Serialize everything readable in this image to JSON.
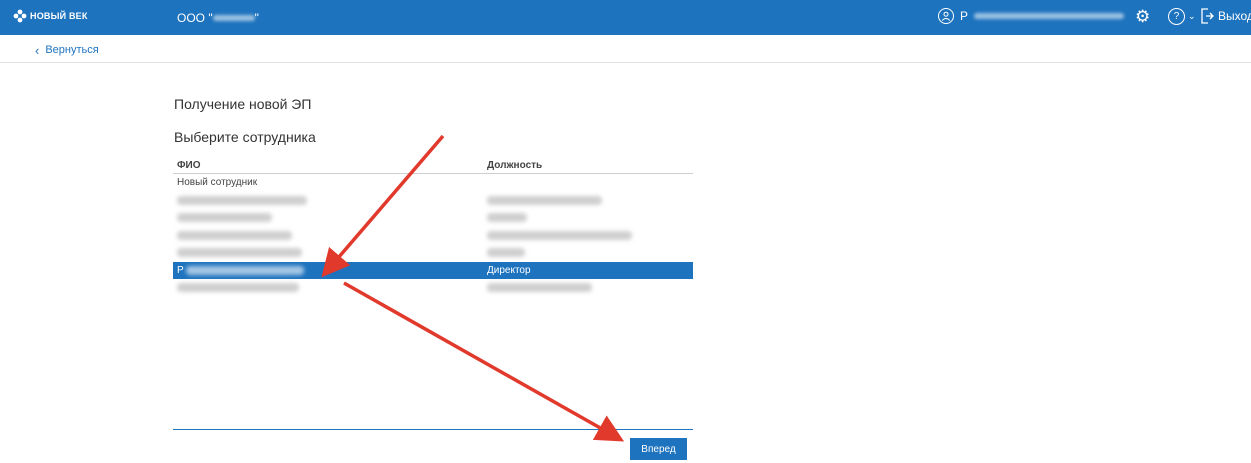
{
  "header": {
    "logo_text": "НОВЫЙ ВЕК",
    "logo_sub": "",
    "org_prefix": "ООО \"",
    "org_suffix": "\"",
    "exit_label": "Выход",
    "user_initial": "Р"
  },
  "nav": {
    "back_label": "Вернуться"
  },
  "page": {
    "title": "Получение новой ЭП",
    "section_title": "Выберите сотрудника"
  },
  "table": {
    "columns": {
      "name": "ФИО",
      "position": "Должность"
    },
    "rows": [
      {
        "name": "Новый сотрудник",
        "position": "",
        "selected": false
      },
      {
        "name": "",
        "position": "",
        "selected": false
      },
      {
        "name": "",
        "position": "",
        "selected": false
      },
      {
        "name": "",
        "position": "",
        "selected": false
      },
      {
        "name": "",
        "position": "",
        "selected": false
      },
      {
        "name": "Р",
        "position": "Директор",
        "selected": true
      },
      {
        "name": "",
        "position": "",
        "selected": false
      }
    ]
  },
  "actions": {
    "next_label": "Вперед"
  },
  "colors": {
    "accent": "#1e73be",
    "annotation": "#e1392b"
  },
  "icons": [
    "logo-icon",
    "user-icon",
    "gear-icon",
    "help-icon",
    "chevron-down-icon",
    "exit-icon",
    "chevron-left-icon"
  ]
}
